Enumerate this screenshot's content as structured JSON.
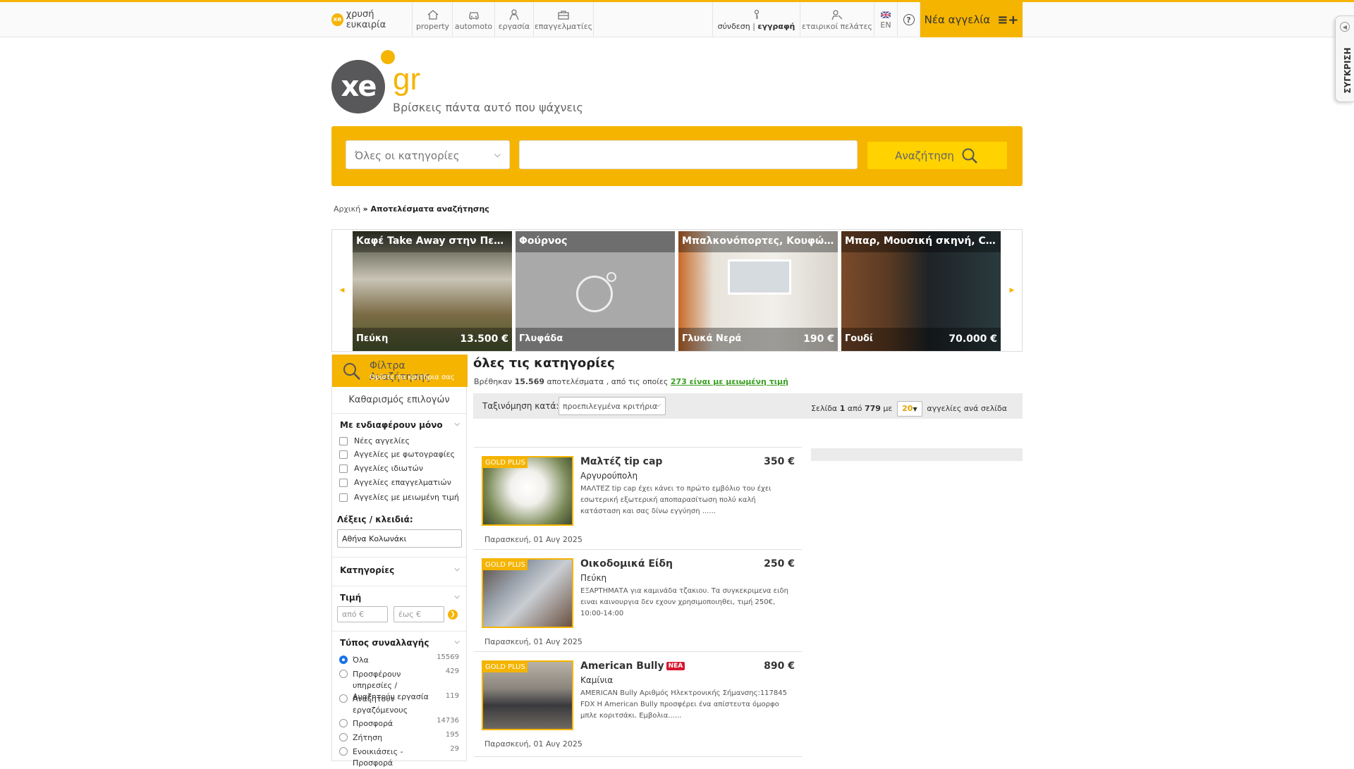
{
  "topbar": {
    "gold_label": "χρυσή ευκαιρία",
    "nav": [
      {
        "label": "property",
        "icon": "house-icon"
      },
      {
        "label": "automoto",
        "icon": "car-icon"
      },
      {
        "label": "εργασία",
        "icon": "person-icon"
      },
      {
        "label": "επαγγελματίες",
        "icon": "briefcase-icon"
      }
    ],
    "login_label": "σύνδεση",
    "register_label": "εγγραφή",
    "business_label": "εταιρικοί πελάτες",
    "lang_label": "EN",
    "help_label": "?",
    "new_ad_label": "Νέα αγγελία"
  },
  "logo": {
    "mark": "xe",
    "suffix": "gr",
    "tagline": "Βρίσκεις πάντα αυτό που ψάχνεις"
  },
  "search": {
    "category_value": "Όλες οι κατηγορίες",
    "query": "",
    "button_label": "Αναζήτηση"
  },
  "breadcrumb": {
    "home": "Αρχική",
    "current": "» Αποτελέσματα αναζήτησης"
  },
  "carousel": [
    {
      "title": "Καφέ Take Away στην Πεύκη",
      "location": "Πεύκη",
      "price": "13.500 €"
    },
    {
      "title": "Φούρνος",
      "location": "Γλυφάδα",
      "price": ""
    },
    {
      "title": "Μπαλκονόπορτες, Κουφώμ...",
      "location": "Γλυκά Νερά",
      "price": "190 €"
    },
    {
      "title": "Μπαρ, Μουσική σκηνή, Club",
      "location": "Γουδί",
      "price": "70.000 €"
    }
  ],
  "filters": {
    "head_title": "Φίλτρα Αναζήτησης",
    "head_sub": "Ορίστε τα κριτήρια σας",
    "clear_label": "Καθαρισμός επιλογών",
    "interest_title": "Με ενδιαφέρουν μόνο",
    "interest_options": [
      "Νέες αγγελίες",
      "Αγγελίες με φωτογραφίες",
      "Αγγελίες ιδιωτών",
      "Αγγελίες επαγγελματιών",
      "Αγγελίες με μειωμένη τιμή"
    ],
    "keywords_label": "Λέξεις / κλειδιά:",
    "keywords_value": "Αθήνα Κολωνάκι",
    "categories_title": "Κατηγορίες",
    "price_title": "Τιμή",
    "price_from_placeholder": "από €",
    "price_to_placeholder": "έως €",
    "deal_title": "Τύπος συναλλαγής",
    "deal_options": [
      {
        "label": "Όλα",
        "count": "15569",
        "selected": true
      },
      {
        "label": "Προσφέρουν υπηρεσίες / Αναζητούν εργασία",
        "count": "429",
        "selected": false
      },
      {
        "label": "Αναζητούν εργαζόμενους",
        "count": "119",
        "selected": false
      },
      {
        "label": "Προσφορά",
        "count": "14736",
        "selected": false
      },
      {
        "label": "Ζήτηση",
        "count": "195",
        "selected": false
      },
      {
        "label": "Ενοικιάσεις - Προσφορά",
        "count": "29",
        "selected": false
      }
    ]
  },
  "results": {
    "title": "όλες τις κατηγορίες",
    "found_prefix": "Βρέθηκαν",
    "found_count": "15.569",
    "found_mid": "αποτελέσματα , από τις οποίες",
    "reduced_link": "273 είναι με μειωμένη τιμή",
    "sort_label": "Ταξινόμηση κατά:",
    "sort_value": "προεπιλεγμένα κριτήρια",
    "page_label": "Σελίδα",
    "page_current": "1",
    "page_of": "από",
    "page_total": "779",
    "page_with": "με",
    "per_page": "20",
    "per_page_suffix": "αγγελίες ανά σελίδα"
  },
  "listings": [
    {
      "badge": "GOLD PLUS",
      "title": "Μαλτέζ tip cap",
      "is_new": false,
      "price": "350 €",
      "location": "Αργυρούπολη",
      "description": "ΜΑΛΤΕΖ tip cap έχει κάνει το πρώτο εμβόλιο του έχει εσωτερική εξωτερική αποπαρασίτωση πολύ καλή κατάσταση και σας δίνω εγγύηση ......",
      "date": "Παρασκευή, 01 Αυγ 2025"
    },
    {
      "badge": "GOLD PLUS",
      "title": "Οικοδομικά Είδη",
      "is_new": false,
      "price": "250 €",
      "location": "Πεύκη",
      "description": "ΕΞΑΡΤΗΜΑΤΑ για καμινάδα τζακιου. Τα συγκεκριμενα ειδη ειναι καινουργια δεν εχουν χρησιμοποιηθει, τιμή 250€, 10:00-14:00",
      "date": "Παρασκευή, 01 Αυγ 2025"
    },
    {
      "badge": "GOLD PLUS",
      "title": "American Bully",
      "is_new": true,
      "new_label": "ΝΕΑ",
      "price": "890 €",
      "location": "Καμίνια",
      "description": "AMERICAN Bully Αριθμός Ηλεκτρονικής Σήμανσης:117845 FDX Η American Bully προσφέρει ένα απίστευτα όμορφο μπλε κοριτσάκι. Εμβολια......",
      "date": "Παρασκευή, 01 Αυγ 2025"
    }
  ],
  "compare_tab": {
    "label": "ΣΥΓΚΡΙΣΗ"
  },
  "colors": {
    "accent": "#f5b400",
    "link_green": "#3a9f22",
    "new_badge": "#d6182f"
  }
}
